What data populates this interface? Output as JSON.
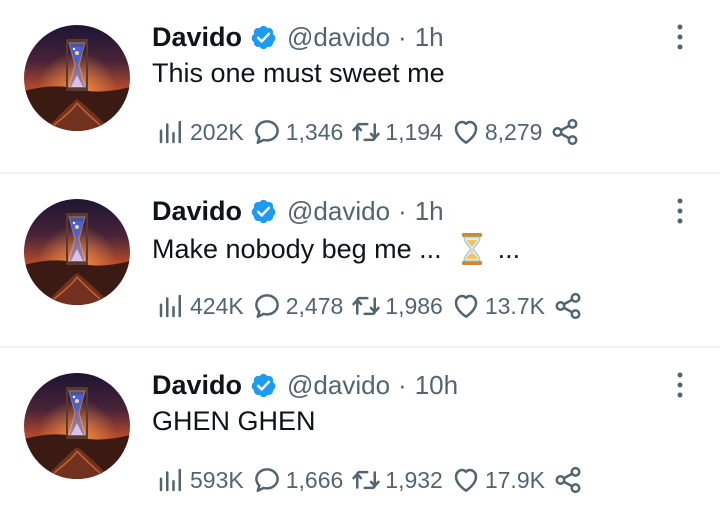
{
  "tweets": [
    {
      "name": "Davido",
      "handle": "@davido",
      "separator": "·",
      "time": "1h",
      "text": "This one must sweet me",
      "text_after": "",
      "views": "202K",
      "replies": "1,346",
      "retweets": "1,194",
      "likes": "8,279"
    },
    {
      "name": "Davido",
      "handle": "@davido",
      "separator": "·",
      "time": "1h",
      "text": "Make nobody beg me ...",
      "text_after": "...",
      "views": "424K",
      "replies": "2,478",
      "retweets": "1,986",
      "likes": "13.7K"
    },
    {
      "name": "Davido",
      "handle": "@davido",
      "separator": "·",
      "time": "10h",
      "text": "GHEN GHEN",
      "text_after": "",
      "views": "593K",
      "replies": "1,666",
      "retweets": "1,932",
      "likes": "17.9K"
    }
  ],
  "colors": {
    "verified": "#1d9bf0",
    "secondary_text": "#536471",
    "divider": "#eff3f4"
  },
  "icons": [
    "verified-badge-icon",
    "more-icon",
    "views-icon",
    "reply-icon",
    "retweet-icon",
    "like-icon",
    "share-icon",
    "hourglass-icon"
  ]
}
